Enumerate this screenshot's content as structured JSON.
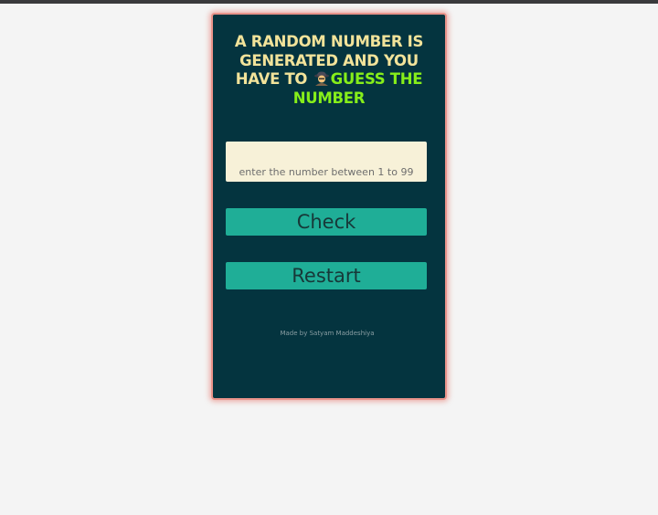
{
  "game": {
    "title_part1": "A RANDOM NUMBER IS GENERATED AND YOU HAVE TO",
    "title_icon": "detective-icon",
    "title_highlight": "GUESS THE NUMBER",
    "input": {
      "value": "",
      "placeholder": "enter the number between 1 to 99"
    },
    "check_label": "Check",
    "restart_label": "Restart",
    "credit": "Made by Satyam Maddeshiya"
  },
  "colors": {
    "page_background": "#f4f4f4",
    "card_background": "#04343f",
    "card_border": "#e8938a",
    "title_text": "#f2e39a",
    "title_highlight": "#86ee1a",
    "input_background": "#f7f1d8",
    "button_background": "#1fae97",
    "button_text": "#173838"
  }
}
